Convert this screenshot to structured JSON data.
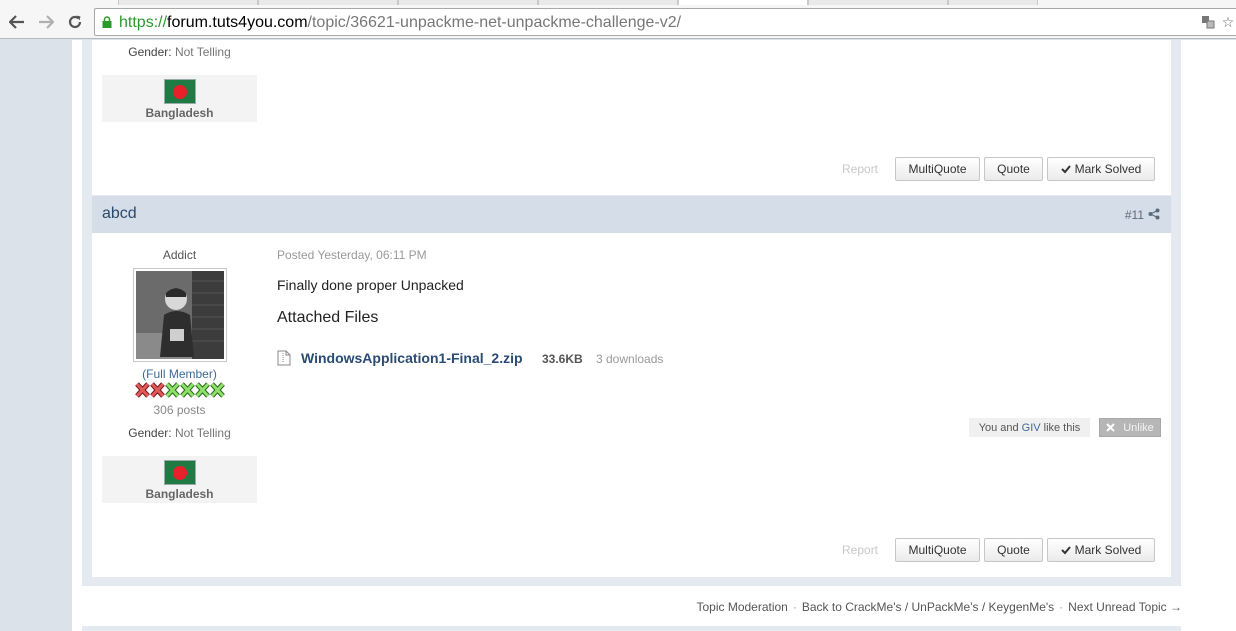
{
  "browser": {
    "url": {
      "scheme": "https://",
      "host": "forum.tuts4you.com",
      "path": "/topic/36621-unpackme-net-unpackme-challenge-v2/"
    },
    "icons": [
      "back-icon",
      "forward-icon",
      "reload-icon",
      "lock-icon",
      "translate-icon",
      "star-icon"
    ]
  },
  "post_prev": {
    "gender_label": "Gender:",
    "gender_value": "Not Telling",
    "country": "Bangladesh",
    "report": "Report",
    "multiquote": "MultiQuote",
    "quote": "Quote",
    "mark_solved": "Mark Solved"
  },
  "post": {
    "author": "abcd",
    "number": "#11",
    "rank_title": "Addict",
    "member_group": "(Full Member)",
    "pips": {
      "red": 2,
      "green": 4
    },
    "post_count": "306 posts",
    "gender_label": "Gender:",
    "gender_value": "Not Telling",
    "country": "Bangladesh",
    "posted": "Posted Yesterday, 06:11 PM",
    "body": "Finally done proper Unpacked",
    "attachments_title": "Attached Files",
    "attachment": {
      "name": "WindowsApplication1-Final_2.zip",
      "size": "33.6KB",
      "downloads": "3 downloads"
    },
    "likes": {
      "prefix": "You and",
      "user": "GIV",
      "suffix": "like this"
    },
    "unlike": "Unlike",
    "report": "Report",
    "multiquote": "MultiQuote",
    "quote": "Quote",
    "mark_solved": "Mark Solved"
  },
  "footer": {
    "moderation": "Topic Moderation",
    "back": "Back to CrackMe's / UnPackMe's / KeygenMe's",
    "next": "Next Unread Topic →",
    "separator": "·"
  },
  "colors": {
    "header_bg": "#d5dde8",
    "link": "#2a4b73",
    "url_green": "#2a9a2a"
  }
}
